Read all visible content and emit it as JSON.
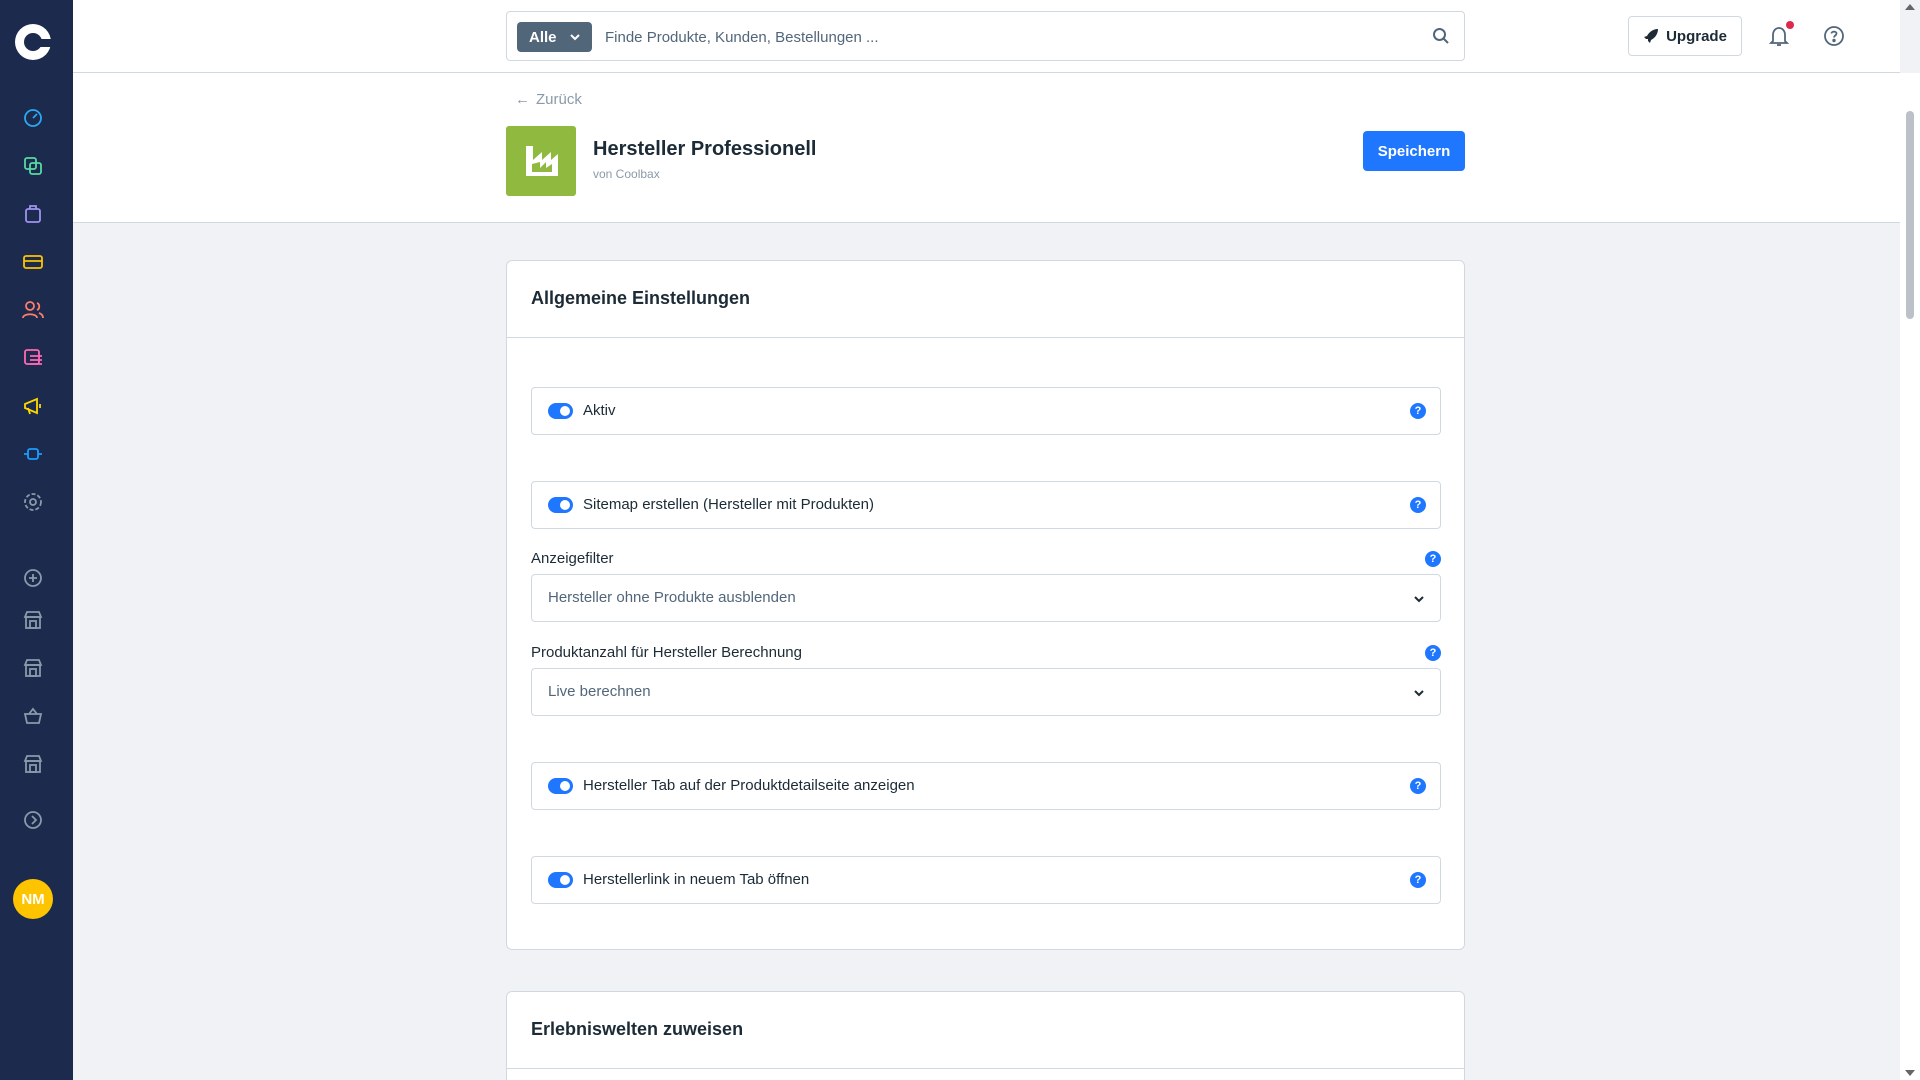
{
  "search": {
    "type_label": "Alle",
    "placeholder": "Finde Produkte, Kunden, Bestellungen ..."
  },
  "topbar": {
    "upgrade_label": "Upgrade"
  },
  "header": {
    "back_label": "Zurück",
    "title": "Hersteller Professionell",
    "subtitle": "von Coolbax",
    "save_label": "Speichern"
  },
  "user": {
    "initials": "NM"
  },
  "sidebar": {
    "icons": [
      {
        "name": "dashboard-icon",
        "color": "#2aa9f2"
      },
      {
        "name": "catalog-icon",
        "color": "#57d9a3"
      },
      {
        "name": "orders-icon",
        "color": "#a092f0"
      },
      {
        "name": "payment-icon",
        "color": "#ffc400"
      },
      {
        "name": "customers-icon",
        "color": "#ff7d6a"
      },
      {
        "name": "content-icon",
        "color": "#ff68b4"
      },
      {
        "name": "marketing-icon",
        "color": "#ffd700"
      },
      {
        "name": "extensions-icon",
        "color": "#189eff"
      },
      {
        "name": "settings-icon",
        "color": "#8a9aa9"
      }
    ]
  },
  "general_settings": {
    "title": "Allgemeine Einstellungen",
    "toggles": [
      {
        "label": "Aktiv",
        "enabled": true
      },
      {
        "label": "Sitemap erstellen (Hersteller mit Produkten)",
        "enabled": true
      },
      {
        "label": "Hersteller Tab auf der Produktdetailseite anzeigen",
        "enabled": true
      },
      {
        "label": "Herstellerlink in neuem Tab öffnen",
        "enabled": true
      }
    ],
    "display_filter": {
      "label": "Anzeigefilter",
      "value": "Hersteller ohne Produkte ausblenden"
    },
    "product_count": {
      "label": "Produktanzahl für Hersteller Berechnung",
      "value": "Live berechnen"
    }
  },
  "experience_worlds": {
    "title": "Erlebniswelten zuweisen"
  },
  "colors": {
    "sidebar_bg": "#1c2a4d",
    "accent": "#1f77ff",
    "avatar_bg": "#ffc400",
    "entity_icon_bg": "#8fba3f",
    "notification_dot": "#de294c"
  }
}
